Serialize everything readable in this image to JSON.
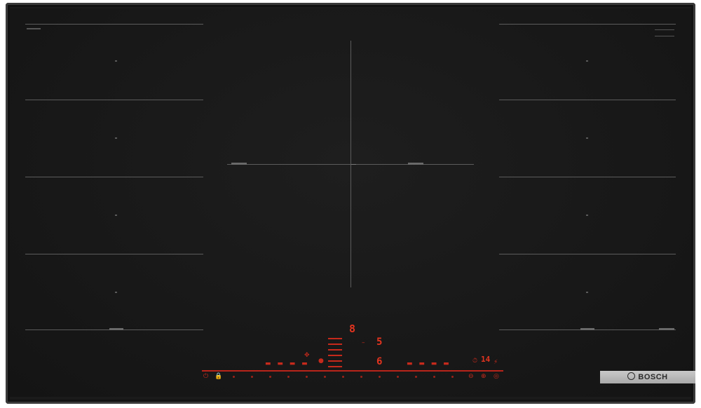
{
  "brand": {
    "name": "BOSCH"
  },
  "display": {
    "left_digit": "8",
    "right_digit_top": "5",
    "right_digit_bottom": "6",
    "timer_value": "14"
  },
  "colors": {
    "glass": "#181818",
    "frame": "#3a3a3a",
    "zone_lines": "#5c5c5c",
    "control_red": "#e0301e",
    "badge_bg": "#bcbcbc"
  },
  "icons": {
    "brand_logo": "bosch-logo-icon",
    "power": "power-icon",
    "lock": "lock-icon",
    "timer": "timer-icon",
    "move": "move-icon",
    "boost": "boost-icon"
  }
}
